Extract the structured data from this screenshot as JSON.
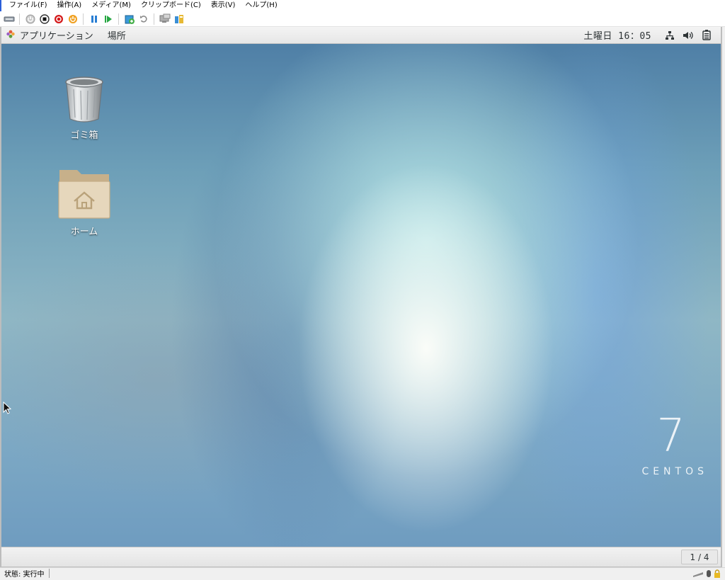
{
  "host": {
    "menu": [
      "ファイル(F)",
      "操作(A)",
      "メディア(M)",
      "クリップボード(C)",
      "表示(V)",
      "ヘルプ(H)"
    ],
    "status_text": "状態: 実行中",
    "accent_color": "#2b5fd9"
  },
  "guest_panel": {
    "applications": "アプリケーション",
    "places": "場所",
    "clock": "土曜日 16：05"
  },
  "desktop": {
    "trash_label": "ゴミ箱",
    "home_label": "ホーム",
    "brand_number": "7",
    "brand_name": "CENTOS"
  },
  "guest_bottom": {
    "workspace": "1 / 4"
  }
}
